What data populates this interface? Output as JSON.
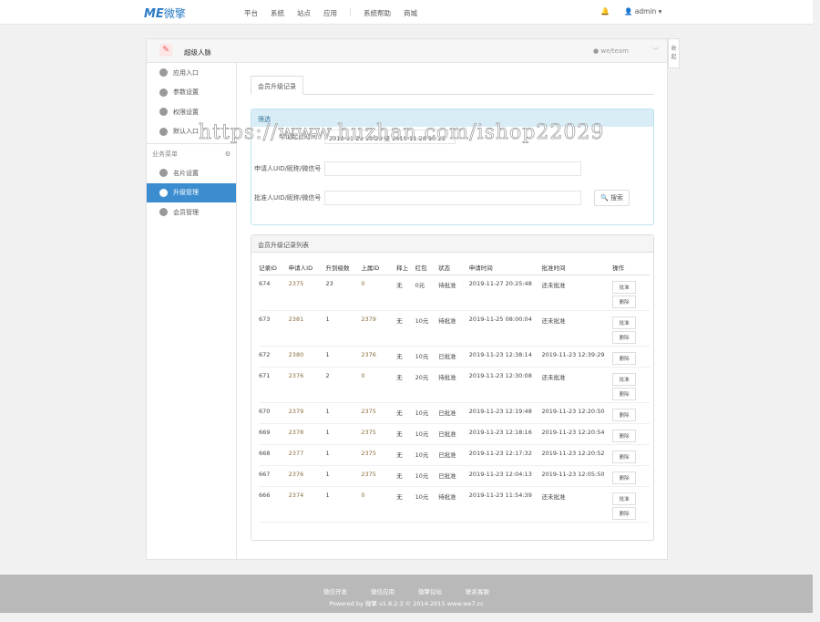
{
  "topbar": {
    "logo_mark": "ME",
    "logo_text": "微擎",
    "nav": [
      "平台",
      "系统",
      "站点",
      "应用",
      "系统帮助",
      "商城"
    ],
    "user": "admin ▾"
  },
  "panel": {
    "account_name": "超级人脉",
    "account_type": "we/team",
    "right_tab": "收起"
  },
  "sidebar": {
    "items": [
      "应用入口",
      "参数设置",
      "权限设置",
      "默认入口"
    ],
    "group": "业务菜单",
    "group_items": [
      "名片设置",
      "升级管理",
      "会员管理"
    ],
    "active": "升级管理"
  },
  "tabs": [
    "会员升级记录"
  ],
  "search": {
    "title": "筛选",
    "fields": [
      {
        "label": "申请起止时间",
        "value": "2018-11-21 10:23 至 2019-11-28 10:23"
      },
      {
        "label": "申请人UID/昵称/微信号",
        "value": ""
      },
      {
        "label": "批准人UID/昵称/微信号",
        "value": ""
      }
    ],
    "button": "搜索"
  },
  "list": {
    "title": "会员升级记录列表",
    "columns": [
      "记录ID",
      "申请人ID",
      "升到级数",
      "上属ID",
      "释上",
      "红包",
      "状态",
      "申请时间",
      "批准时间",
      "操作"
    ],
    "approve_label": "批准",
    "delete_label": "删除",
    "rows": [
      [
        "674",
        "2375",
        "23",
        "0",
        "无",
        "0元",
        "待批准",
        "2019-11-27 20:25:48",
        "还未批准"
      ],
      [
        "673",
        "2381",
        "1",
        "2379",
        "无",
        "10元",
        "待批准",
        "2019-11-25 08:00:04",
        "还未批准"
      ],
      [
        "672",
        "2380",
        "1",
        "2376",
        "无",
        "10元",
        "已批准",
        "2019-11-23 12:38:14",
        "2019-11-23 12:39:29"
      ],
      [
        "671",
        "2376",
        "2",
        "0",
        "无",
        "20元",
        "待批准",
        "2019-11-23 12:30:08",
        "还未批准"
      ],
      [
        "670",
        "2379",
        "1",
        "2375",
        "无",
        "10元",
        "已批准",
        "2019-11-23 12:19:48",
        "2019-11-23 12:20:50"
      ],
      [
        "669",
        "2378",
        "1",
        "2375",
        "无",
        "10元",
        "已批准",
        "2019-11-23 12:18:16",
        "2019-11-23 12:20:54"
      ],
      [
        "668",
        "2377",
        "1",
        "2375",
        "无",
        "10元",
        "已批准",
        "2019-11-23 12:17:32",
        "2019-11-23 12:20:52"
      ],
      [
        "667",
        "2376",
        "1",
        "2375",
        "无",
        "10元",
        "已批准",
        "2019-11-23 12:04:13",
        "2019-11-23 12:05:50"
      ],
      [
        "666",
        "2374",
        "1",
        "0",
        "无",
        "10元",
        "待批准",
        "2019-11-23 11:54:39",
        "还未批准"
      ]
    ]
  },
  "footer": {
    "links": [
      "微信开发",
      "微信应用",
      "微擎论坛",
      "联系客服"
    ],
    "powered": "Powered by 微擎 v1.8.2.3 © 2014-2015 www.we7.cc"
  },
  "watermark": "https://www.huzhan.com/ishop22029"
}
